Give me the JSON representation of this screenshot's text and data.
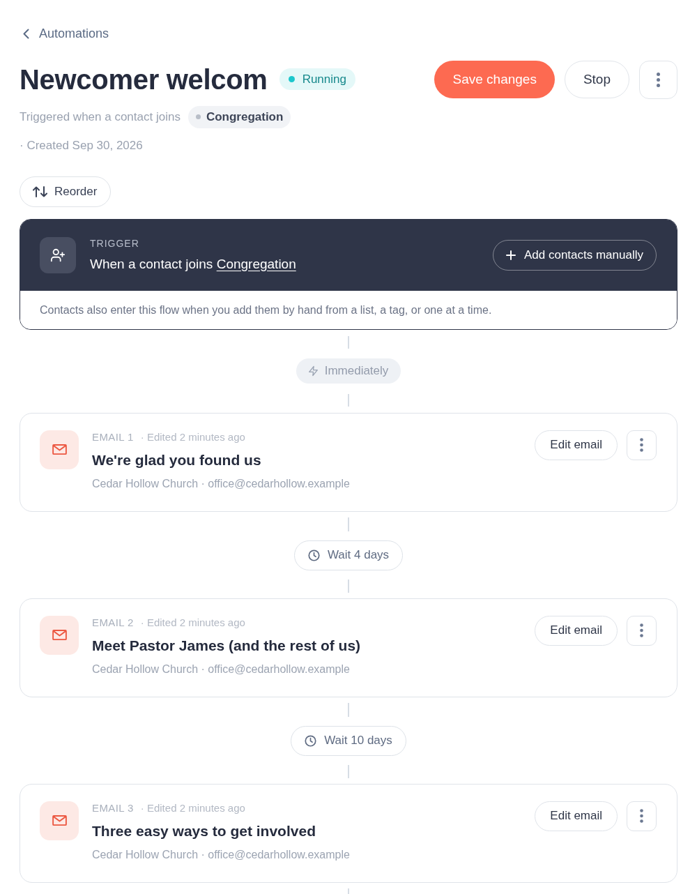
{
  "back_link": {
    "label": "Automations"
  },
  "header": {
    "title": "Newcomer welcom",
    "status": {
      "kind": "running",
      "label": "Running"
    },
    "actions": [
      {
        "kind": "primary",
        "label": "Save changes"
      },
      {
        "kind": "secondary",
        "label": "Stop"
      },
      {
        "kind": "more"
      }
    ]
  },
  "meta": {
    "trigger_text": "Triggered when a contact joins",
    "segment": "Congregation",
    "created": "· Created Sep 30, 2026"
  },
  "toolbar": {
    "reorder_button": "Reorder"
  },
  "trigger_card": {
    "label": "TRIGGER",
    "text": "When a contact joins",
    "link": "Congregation",
    "button": "Add contacts manually",
    "note": "Contacts also enter this flow when you add them by hand from a list, a tag, or one at a time."
  },
  "steps": [
    {
      "kind": "immediate",
      "label": "Immediately"
    },
    {
      "kind": "email",
      "label": "EMAIL 1",
      "edited": "· Edited 2 minutes ago",
      "subject": "We're glad you found us",
      "sender": "Cedar Hollow Church · office@cedarhollow.example",
      "button": "Edit email"
    },
    {
      "kind": "wait",
      "label": "Wait 4 days"
    },
    {
      "kind": "email",
      "label": "EMAIL 2",
      "edited": "· Edited 2 minutes ago",
      "subject": "Meet Pastor James (and the rest of us)",
      "sender": "Cedar Hollow Church · office@cedarhollow.example",
      "button": "Edit email"
    },
    {
      "kind": "wait",
      "label": "Wait 10 days"
    },
    {
      "kind": "email",
      "label": "EMAIL 3",
      "edited": "· Edited 2 minutes ago",
      "subject": "Three easy ways to get involved",
      "sender": "Cedar Hollow Church · office@cedarhollow.example",
      "button": "Edit email"
    }
  ]
}
